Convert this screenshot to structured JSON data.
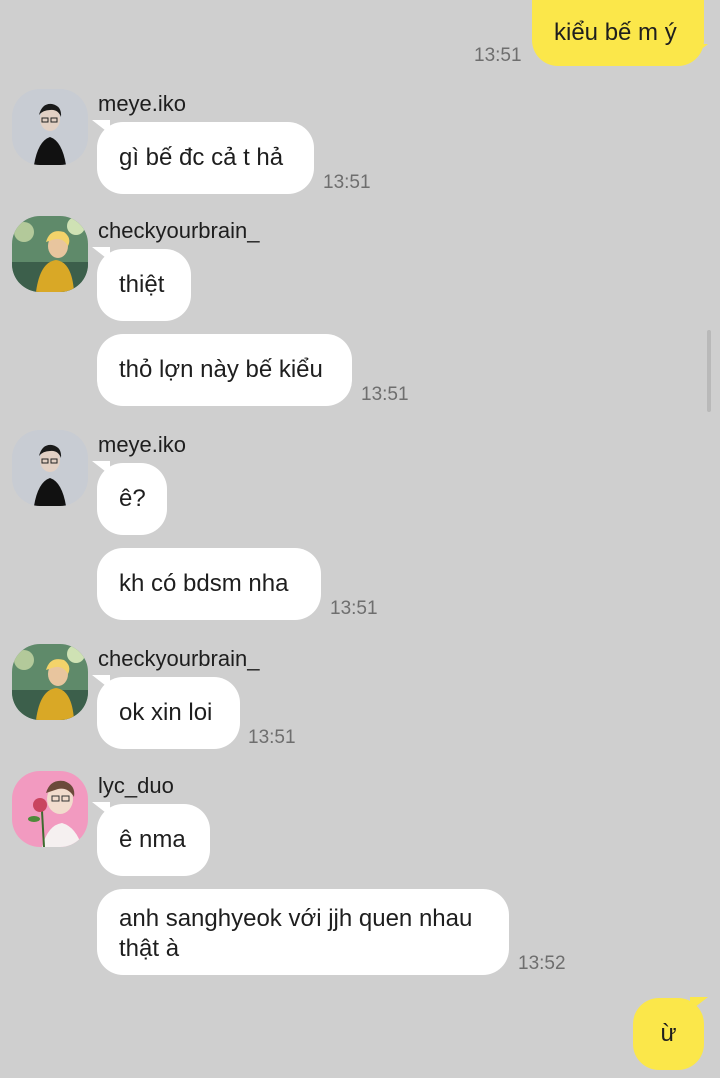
{
  "messages": [
    {
      "text": "kiểu bế m ý",
      "time": "13:51"
    },
    {
      "sender": "meye.iko",
      "text": "gì bế đc cả t hả",
      "time": "13:51"
    },
    {
      "sender": "checkyourbrain_",
      "text": "thiệt"
    },
    {
      "text": "thỏ lợn này bế kiểu",
      "time": "13:51"
    },
    {
      "sender": "meye.iko",
      "text": "ê?"
    },
    {
      "text": "kh có bdsm nha",
      "time": "13:51"
    },
    {
      "sender": "checkyourbrain_",
      "text": "ok xin loi",
      "time": "13:51"
    },
    {
      "sender": "lyc_duo",
      "text": "ê nma"
    },
    {
      "text": "anh sanghyeok với jjh quen nhau thật à",
      "time": "13:52"
    },
    {
      "text": "ừ"
    }
  ],
  "colors": {
    "background": "#cfcfcf",
    "own_bubble": "#fbe74a",
    "other_bubble": "#ffffff",
    "timestamp": "#6e6e6e"
  },
  "avatars": {
    "meye_iko": "dark-portrait-avatar",
    "checkyourbrain": "yellow-jacket-avatar",
    "lyc_duo": "pink-rose-avatar"
  }
}
